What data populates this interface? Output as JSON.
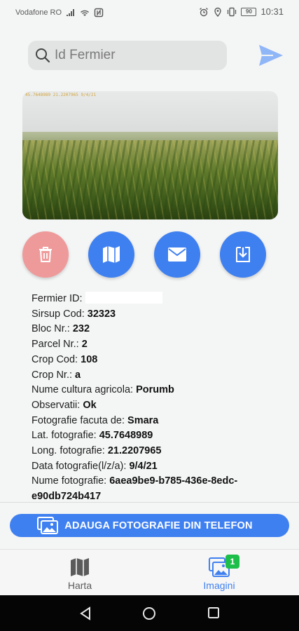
{
  "status_bar": {
    "carrier": "Vodafone RO",
    "battery": "90",
    "time": "10:31"
  },
  "search": {
    "placeholder": "Id Fermier"
  },
  "photo": {
    "overlay_text": "45.7648989 21.2207965 9/4/21"
  },
  "actions": {
    "delete": "trash-icon",
    "map": "map-icon",
    "email": "mail-icon",
    "download": "download-icon",
    "delete_color": "#ef9a9a",
    "accent": "#3f80f0"
  },
  "details": {
    "fermier_id_label": "Fermier ID:",
    "fermier_id_value": "",
    "sirsup_label": "Sirsup Cod:",
    "sirsup_value": "32323",
    "bloc_label": "Bloc Nr.:",
    "bloc_value": "232",
    "parcel_label": "Parcel Nr.:",
    "parcel_value": "2",
    "crop_cod_label": "Crop Cod:",
    "crop_cod_value": "108",
    "crop_nr_label": "Crop Nr.:",
    "crop_nr_value": "a",
    "cultura_label": "Nume cultura agricola:",
    "cultura_value": "Porumb",
    "observatii_label": "Observatii:",
    "observatii_value": "Ok",
    "facuta_label": "Fotografie facuta de:",
    "facuta_value": "Smara",
    "lat_label": "Lat. fotografie:",
    "lat_value": "45.7648989",
    "long_label": "Long. fotografie:",
    "long_value": "21.2207965",
    "data_label": "Data fotografie(l/z/a):",
    "data_value": "9/4/21",
    "nume_label": "Nume fotografie:",
    "nume_value": "6aea9be9-b785-436e-8edc-e90db724b417"
  },
  "add_button": {
    "label": "ADAUGA FOTOGRAFIE DIN TELEFON"
  },
  "bottom_nav": {
    "harta": "Harta",
    "imagini": "Imagini",
    "imagini_badge": "1",
    "active": "Imagini"
  }
}
